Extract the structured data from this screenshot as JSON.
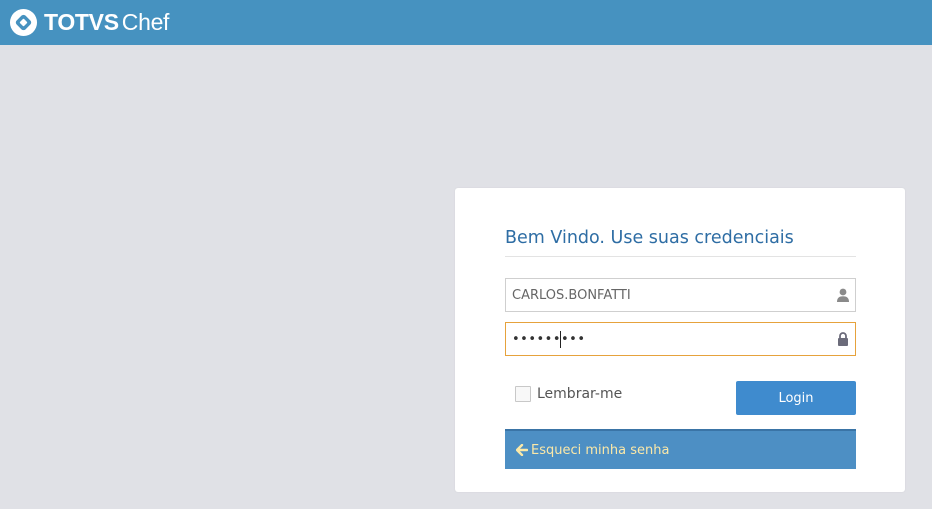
{
  "header": {
    "brand": "TOTVS",
    "product": "Chef",
    "background_color": "#4692c0",
    "logo_icon": "totvs-logo-icon"
  },
  "login": {
    "welcome": "Bem Vindo. Use suas credenciais",
    "username": {
      "value": "CARLOS.BONFATTI",
      "icon": "user-icon"
    },
    "password": {
      "value": "•••••••••",
      "icon": "lock-icon",
      "focus_color": "#e6a23c"
    },
    "remember_label": "Lembrar-me",
    "remember_checked": false,
    "login_button": "Login",
    "login_button_color": "#3f8bce",
    "forgot_label": "Esqueci minha senha",
    "forgot_icon": "arrow-left-icon",
    "forgot_text_color": "#fbe8a8"
  }
}
